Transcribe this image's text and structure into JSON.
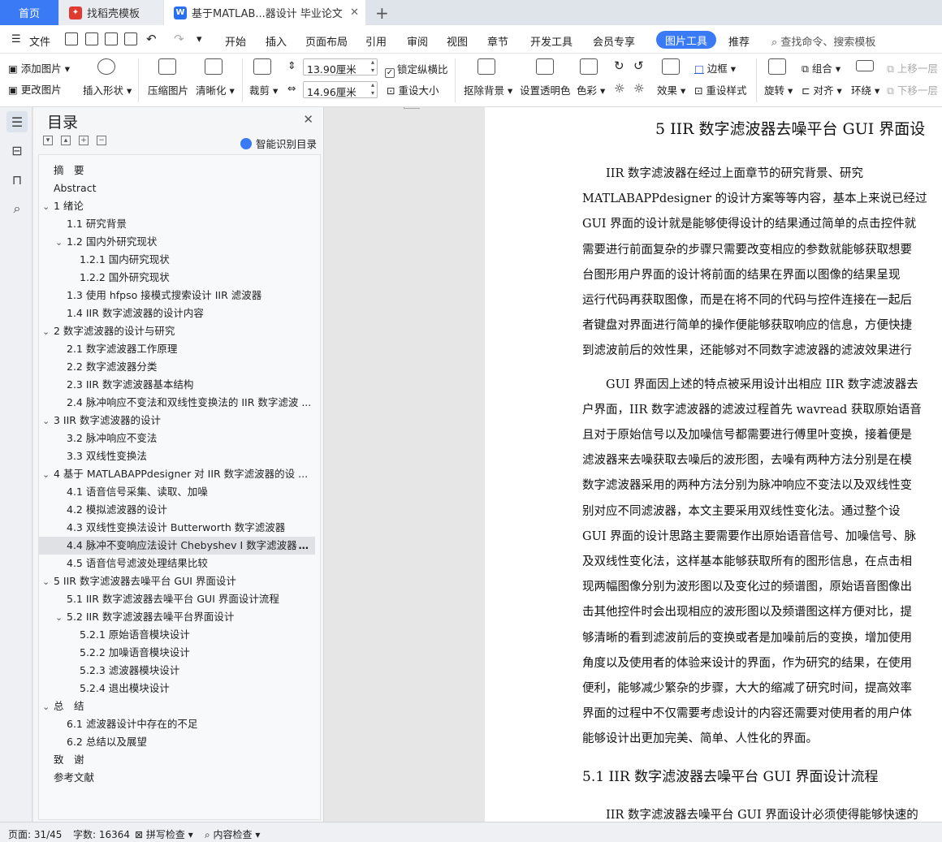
{
  "tabs": {
    "home": "首页",
    "doc1": "找稻壳模板",
    "doc2": "基于MATLAB...器设计 毕业论文",
    "add": "+"
  },
  "menu": {
    "file": "文件",
    "items": [
      "开始",
      "插入",
      "页面布局",
      "引用",
      "审阅",
      "视图",
      "章节",
      "开发工具",
      "会员专享"
    ],
    "active": "图片工具",
    "recommend": "推荐",
    "search": "查找命令、搜索模板"
  },
  "ribbon": {
    "add_image": "添加图片",
    "change_image": "更改图片",
    "insert_shape": "插入形状",
    "compress": "压缩图片",
    "sharpen": "清晰化",
    "crop": "裁剪",
    "height": "13.90厘米",
    "width": "14.96厘米",
    "lock_ratio": "锁定纵横比",
    "reset_size": "重设大小",
    "remove_bg": "抠除背景",
    "set_transparent": "设置透明色",
    "color": "色彩",
    "effects": "效果",
    "reset_style": "重设样式",
    "border": "边框",
    "rotate": "旋转",
    "group": "组合",
    "align": "对齐",
    "wrap": "环绕",
    "bring_forward": "上移一层",
    "send_backward": "下移一层"
  },
  "toc": {
    "title": "目录",
    "smart": "智能识别目录",
    "items": [
      {
        "text": "摘　要",
        "level": 0,
        "chev": ""
      },
      {
        "text": "Abstract",
        "level": 0,
        "chev": ""
      },
      {
        "text": "1  绪论",
        "level": 0,
        "chev": "v"
      },
      {
        "text": "1.1  研究背景",
        "level": 1,
        "chev": ""
      },
      {
        "text": "1.2  国内外研究现状",
        "level": 1,
        "chev": "v"
      },
      {
        "text": "1.2.1  国内研究现状",
        "level": 2,
        "chev": ""
      },
      {
        "text": "1.2.2  国外研究现状",
        "level": 2,
        "chev": ""
      },
      {
        "text": "1.3  使用 hfpso 接模式搜索设计 IIR 滤波器",
        "level": 1,
        "chev": ""
      },
      {
        "text": "1.4 IIR 数字滤波器的设计内容",
        "level": 1,
        "chev": ""
      },
      {
        "text": "2  数字滤波器的设计与研究",
        "level": 0,
        "chev": "v"
      },
      {
        "text": "2.1  数字滤波器工作原理",
        "level": 1,
        "chev": ""
      },
      {
        "text": "2.2  数字滤波器分类",
        "level": 1,
        "chev": ""
      },
      {
        "text": "2.3 IIR 数字滤波器基本结构",
        "level": 1,
        "chev": ""
      },
      {
        "text": "2.4  脉冲响应不变法和双线性变换法的 IIR 数字滤波 ...",
        "level": 1,
        "chev": ""
      },
      {
        "text": "3 IIR 数字滤波器的设计",
        "level": 0,
        "chev": "v"
      },
      {
        "text": "3.2  脉冲响应不变法",
        "level": 1,
        "chev": ""
      },
      {
        "text": "3.3  双线性变换法",
        "level": 1,
        "chev": ""
      },
      {
        "text": "4  基于 MATLABAPPdesigner 对 IIR 数字滤波器的设 ...",
        "level": 0,
        "chev": "v"
      },
      {
        "text": "4.1  语音信号采集、读取、加噪",
        "level": 1,
        "chev": ""
      },
      {
        "text": "4.2  模拟滤波器的设计",
        "level": 1,
        "chev": ""
      },
      {
        "text": "4.3  双线性变换法设计 Butterworth 数字滤波器",
        "level": 1,
        "chev": ""
      },
      {
        "text": "4.4  脉冲不变响应法设计 Chebyshev I 数字滤波器",
        "level": 1,
        "chev": "",
        "selected": true
      },
      {
        "text": "4.5  语音信号滤波处理结果比较",
        "level": 1,
        "chev": ""
      },
      {
        "text": "5 IIR 数字滤波器去噪平台 GUI 界面设计",
        "level": 0,
        "chev": "v"
      },
      {
        "text": "5.1 IIR 数字滤波器去噪平台 GUI 界面设计流程",
        "level": 1,
        "chev": ""
      },
      {
        "text": "5.2 IIR 数字滤波器去噪平台界面设计",
        "level": 1,
        "chev": "v"
      },
      {
        "text": "5.2.1  原始语音模块设计",
        "level": 2,
        "chev": ""
      },
      {
        "text": "5.2.2  加噪语音模块设计",
        "level": 2,
        "chev": ""
      },
      {
        "text": "5.2.3  滤波器模块设计",
        "level": 2,
        "chev": ""
      },
      {
        "text": "5.2.4  退出模块设计",
        "level": 2,
        "chev": ""
      },
      {
        "text": "总　结",
        "level": 0,
        "chev": "v"
      },
      {
        "text": "6.1  滤波器设计中存在的不足",
        "level": 1,
        "chev": ""
      },
      {
        "text": "6.2  总结以及展望",
        "level": 1,
        "chev": ""
      },
      {
        "text": "致　谢",
        "level": 0,
        "chev": ""
      },
      {
        "text": "参考文献",
        "level": 0,
        "chev": ""
      }
    ]
  },
  "document": {
    "heading": "5 IIR 数字滤波器去噪平台 GUI 界面设",
    "lines": [
      "　　IIR 数字滤波器在经过上面章节的研究背景、研究",
      "MATLABAPPdesigner 的设计方案等等内容，基本上来说已经过",
      "GUI 界面的设计就是能够使得设计的结果通过简单的点击控件就",
      "需要进行前面复杂的步骤只需要改变相应的参数就能够获取想要",
      "台图形用户界面的设计将前面的结果在界面以图像的结果呈现",
      "运行代码再获取图像，而是在将不同的代码与控件连接在一起后",
      "者键盘对界面进行简单的操作便能够获取响应的信息，方便快捷",
      "到滤波前后的效性果，还能够对不同数字滤波器的滤波效果进行",
      "　　GUI 界面因上述的特点被采用设计出相应 IIR 数字滤波器去",
      "户界面，IIR 数字滤波器的滤波过程首先 wavread 获取原始语音",
      "且对于原始信号以及加噪信号都需要进行傅里叶变换，接着便是",
      "滤波器来去噪获取去噪后的波形图，去噪有两种方法分别是在模",
      "数字滤波器采用的两种方法分别为脉冲响应不变法以及双线性变",
      "别对应不同滤波器，本文主要采用双线性变化法。通过整个设",
      "GUI 界面的设计思路主要需要作出原始语音信号、加噪信号、脉",
      "及双线性变化法，这样基本能够获取所有的图形信息，在点击相",
      "现两幅图像分别为波形图以及变化过的频谱图，原始语音图像出",
      "击其他控件时会出现相应的波形图以及频谱图这样方便对比，提",
      "够清晰的看到滤波前后的变换或者是加噪前后的变换，增加使用",
      "角度以及使用者的体验来设计的界面，作为研究的结果，在使用",
      "便利，能够减少繁杂的步骤，大大的缩减了研究时间，提高效率",
      "界面的过程中不仅需要考虑设计的内容还需要对使用者的用户体",
      "能够设计出更加完美、简单、人性化的界面。"
    ],
    "subheading": "5.1 IIR 数字滤波器去噪平台 GUI 界面设计流程",
    "last_line": "　　IIR 数字滤波器去噪平台 GUI 界面设计必须使得能够快速的"
  },
  "status": {
    "page": "页面: 31/45",
    "words": "字数: 16364",
    "spell": "拼写检查",
    "content": "内容检查"
  }
}
